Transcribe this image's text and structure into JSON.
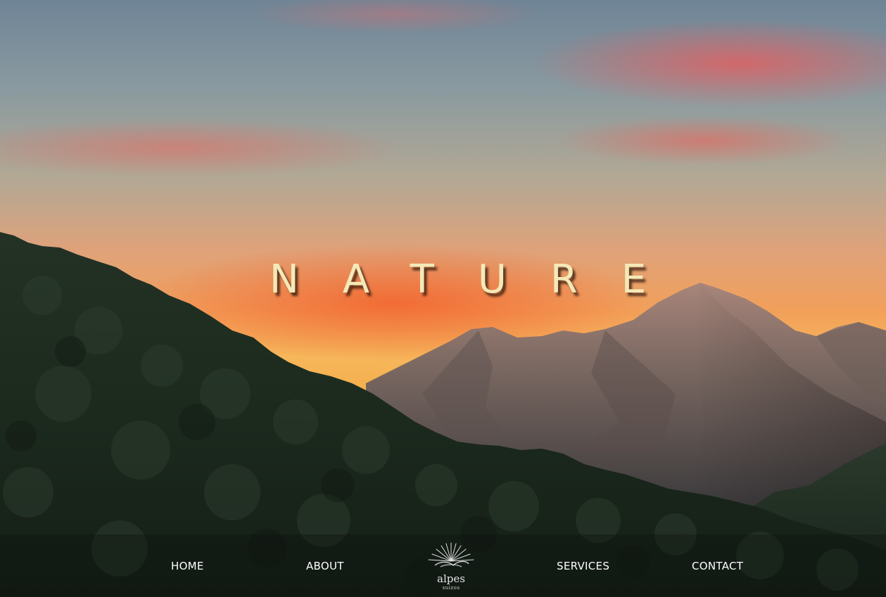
{
  "hero": {
    "title": "NATURE"
  },
  "nav": {
    "items": [
      {
        "label": "HOME"
      },
      {
        "label": "ABOUT"
      },
      {
        "label": "SERVICES"
      },
      {
        "label": "CONTACT"
      }
    ],
    "logo": {
      "name": "alpes",
      "tagline": "suizos",
      "icon": "sunrise-icon"
    }
  },
  "colors": {
    "title_text": "#f4e9b8",
    "nav_text": "#ffffff",
    "sky_top": "#6f8496",
    "sky_glow": "#f3a743",
    "forest": "#1d2a1e",
    "mountain": "#7a6a62"
  }
}
